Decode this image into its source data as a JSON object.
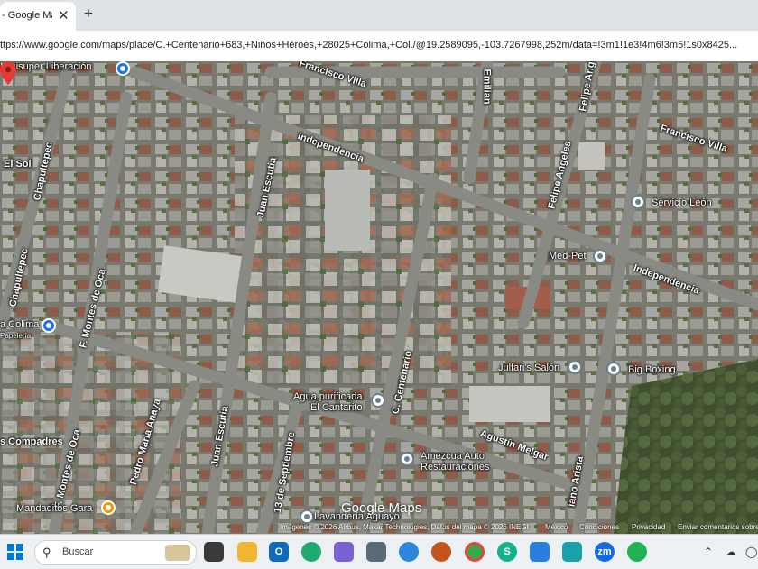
{
  "browser": {
    "tab_title": "- Google Maps",
    "tab_close": "✕",
    "new_tab": "+",
    "url": "ttps://www.google.com/maps/place/C.+Centenario+683,+Niños+Héroes,+28025+Colima,+Col./@19.2589095,-103.7267998,252m/data=!3m1!1e3!4m6!3m5!1s0x8425..."
  },
  "map": {
    "view": "satellite",
    "streets": [
      "Francisco Villa",
      "Independencia",
      "Emilian",
      "Felipe Ang",
      "Francisco Villa",
      "Felipe Angeles",
      "Independencia",
      "Chapultepec",
      "Chapultepec",
      "Juan Escutia",
      "F. Montes de Oca",
      "F. Montes de Oca",
      "Pedro María Anaya",
      "Juan Escutia",
      "C. Centenario",
      "13 de Septiembre",
      "Agustín Melgar",
      "iano Arista",
      "El Sol",
      "s Compadres"
    ],
    "pois": [
      {
        "name": "Minisuper Liberación",
        "pin_color": "#1a73e8"
      },
      {
        "name": "Servicio León",
        "pin_color": "#6b7f8c"
      },
      {
        "name": "Med-Pet",
        "pin_color": "#6b7f8c"
      },
      {
        "name": "Julfari's Salón",
        "pin_color": "#6b7f8c"
      },
      {
        "name": "Big Boxing",
        "pin_color": "#6b7f8c"
      },
      {
        "name": "Agua purificada",
        "sub": "El Cantarito",
        "pin_color": "#6b7f8c"
      },
      {
        "name": "Amezcua Auto",
        "sub": "Restauraciones",
        "pin_color": "#6b7f8c"
      },
      {
        "name": "a Colima",
        "sub": "Papelería",
        "pin_color": "#1a73e8"
      },
      {
        "name": "Mandaditos Gara",
        "pin_color": "#f29900"
      },
      {
        "name": "Lavandería Aguayo",
        "pin_color": "#6b7f8c"
      }
    ],
    "watermark": "Google Maps",
    "attribution": "Imágenes © 2026 Airbus, Maxar Technologies, Datos del mapa © 2026 INEGI",
    "attribution_links": [
      "México",
      "Condiciones",
      "Privacidad",
      "Enviar comentarios sobre"
    ],
    "marker_color": "#e53935"
  },
  "taskbar": {
    "search_placeholder": "Buscar",
    "apps": [
      "file-explorer",
      "outlook",
      "edge",
      "calendar",
      "calculator",
      "onedrive",
      "mail",
      "chrome",
      "skype",
      "designer",
      "photos",
      "zoom",
      "whatsapp"
    ]
  }
}
